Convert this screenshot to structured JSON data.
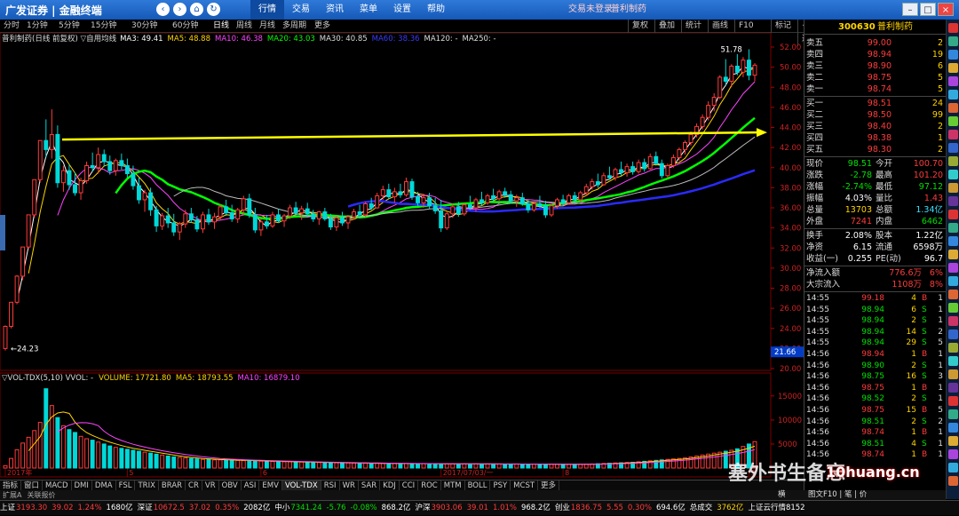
{
  "app": {
    "logo": "广发证券 | 金融终端",
    "menu": [
      "行情",
      "交易",
      "资讯",
      "菜单",
      "设置",
      "帮助"
    ],
    "active_menu": "行情",
    "trade_notice": "交易未登录",
    "title_stock": "普利制药"
  },
  "periods": [
    "分时",
    "1分钟",
    "5分钟",
    "15分钟",
    "30分钟",
    "60分钟",
    "日线",
    "周线",
    "月线",
    "多周期",
    "更多"
  ],
  "selected_period": "日线",
  "tools": [
    "复权",
    "叠加",
    "统计",
    "画线",
    "F10",
    "标记",
    "+自选",
    "返回"
  ],
  "main_legend": {
    "name": "普利制药(日线 前复权) ▽自用均线",
    "ma": [
      {
        "label": "MA3: 49.41",
        "color": "#ffffff"
      },
      {
        "label": "MA5: 48.88",
        "color": "#ffd400"
      },
      {
        "label": "MA10: 46.38",
        "color": "#ff44ff"
      },
      {
        "label": "MA20: 43.03",
        "color": "#00ff00"
      },
      {
        "label": "MA30: 40.85",
        "color": "#dddddd"
      },
      {
        "label": "MA60: 38.36",
        "color": "#3a3aff"
      },
      {
        "label": "MA120: -",
        "color": "#dddddd"
      },
      {
        "label": "MA250: -",
        "color": "#dddddd"
      }
    ]
  },
  "vol_legend": {
    "name": "▽VOL-TDX(5,10) VVOL: -",
    "items": [
      {
        "label": "VOLUME: 17721.80",
        "color": "#ffd400"
      },
      {
        "label": "MA5: 18793.55",
        "color": "#ffd400"
      },
      {
        "label": "MA10: 16879.10",
        "color": "#ff44ff"
      }
    ]
  },
  "chart_data": {
    "type": "candlestick",
    "price_axis": {
      "ylim": [
        20,
        52
      ],
      "ticks": [
        20,
        22,
        24,
        26,
        28,
        30,
        32,
        34,
        36,
        38,
        40,
        42,
        44,
        46,
        48,
        50,
        52
      ],
      "labels": [
        "20.00",
        "22.00",
        "24.00",
        "26.00",
        "28.00",
        "30.00",
        "32.00",
        "34.00",
        "36.00",
        "38.00",
        "40.00",
        "42.00",
        "44.00",
        "46.00",
        "48.00",
        "50.00",
        "52.00"
      ]
    },
    "volume_axis": {
      "ylim": [
        0,
        17000
      ],
      "ticks": [
        5000,
        10000,
        15000
      ]
    },
    "x_labels": [
      {
        "label": "2017年",
        "i": 0
      },
      {
        "label": "5",
        "i": 21
      },
      {
        "label": "6",
        "i": 44
      },
      {
        "label": "2017/07/03/一",
        "i": 75
      },
      {
        "label": "8",
        "i": 96
      },
      {
        "label": "9",
        "i": 128
      }
    ],
    "annotations": {
      "high_label": "51.78",
      "low_label": "24.23",
      "price_tag": "21.66"
    },
    "ohlc": [
      [
        22.0,
        24.3,
        21.8,
        24.2
      ],
      [
        24.2,
        26.6,
        24.0,
        26.6
      ],
      [
        26.6,
        29.3,
        26.4,
        29.2
      ],
      [
        29.2,
        32.1,
        28.8,
        32.1
      ],
      [
        32.1,
        35.3,
        31.9,
        35.3
      ],
      [
        35.3,
        38.8,
        35.0,
        38.8
      ],
      [
        38.8,
        42.7,
        38.5,
        42.7
      ],
      [
        42.7,
        44.8,
        41.0,
        41.8
      ],
      [
        41.8,
        45.8,
        40.9,
        43.3
      ],
      [
        43.3,
        44.2,
        38.0,
        38.5
      ],
      [
        38.5,
        40.2,
        37.6,
        39.7
      ],
      [
        39.7,
        40.3,
        37.8,
        38.3
      ],
      [
        38.3,
        39.5,
        37.2,
        37.5
      ],
      [
        37.5,
        39.0,
        36.8,
        38.7
      ],
      [
        38.7,
        40.6,
        38.4,
        40.2
      ],
      [
        40.2,
        41.5,
        39.6,
        40.0
      ],
      [
        40.0,
        42.0,
        39.4,
        41.3
      ],
      [
        41.3,
        41.8,
        40.1,
        40.6
      ],
      [
        40.6,
        41.2,
        39.3,
        39.7
      ],
      [
        39.7,
        40.9,
        39.2,
        40.7
      ],
      [
        40.7,
        41.4,
        39.8,
        40.2
      ],
      [
        40.2,
        40.9,
        39.0,
        39.4
      ],
      [
        39.4,
        40.2,
        37.8,
        38.2
      ],
      [
        38.2,
        39.0,
        36.4,
        36.8
      ],
      [
        36.8,
        37.8,
        35.6,
        37.5
      ],
      [
        37.5,
        38.0,
        35.2,
        35.8
      ],
      [
        35.8,
        36.2,
        33.6,
        34.2
      ],
      [
        34.2,
        35.5,
        33.8,
        35.2
      ],
      [
        35.2,
        36.0,
        34.0,
        34.5
      ],
      [
        34.5,
        35.4,
        33.2,
        33.6
      ],
      [
        33.6,
        34.6,
        32.8,
        34.4
      ],
      [
        34.4,
        35.8,
        34.0,
        35.4
      ],
      [
        35.4,
        36.0,
        34.5,
        34.8
      ],
      [
        34.8,
        35.2,
        33.6,
        33.9
      ],
      [
        33.9,
        35.6,
        33.5,
        35.3
      ],
      [
        35.3,
        35.9,
        34.3,
        34.6
      ],
      [
        34.6,
        35.5,
        33.9,
        35.1
      ],
      [
        35.1,
        36.4,
        34.8,
        36.1
      ],
      [
        36.1,
        36.8,
        35.2,
        35.5
      ],
      [
        35.5,
        36.3,
        34.6,
        34.9
      ],
      [
        34.9,
        36.0,
        34.5,
        35.8
      ],
      [
        35.8,
        37.2,
        35.3,
        36.9
      ],
      [
        36.9,
        37.4,
        35.0,
        35.3
      ],
      [
        35.3,
        36.0,
        33.5,
        33.8
      ],
      [
        33.8,
        34.9,
        33.2,
        34.6
      ],
      [
        34.6,
        35.3,
        33.9,
        34.2
      ],
      [
        34.2,
        35.6,
        34.0,
        35.3
      ],
      [
        35.3,
        35.9,
        34.5,
        34.7
      ],
      [
        34.7,
        35.4,
        34.1,
        35.2
      ],
      [
        35.2,
        36.3,
        34.9,
        36.0
      ],
      [
        36.0,
        36.6,
        35.2,
        35.5
      ],
      [
        35.5,
        36.2,
        34.8,
        35.9
      ],
      [
        35.9,
        36.5,
        35.1,
        35.4
      ],
      [
        35.4,
        35.8,
        34.6,
        34.9
      ],
      [
        34.9,
        35.7,
        34.3,
        35.6
      ],
      [
        35.6,
        36.0,
        34.7,
        34.9
      ],
      [
        34.9,
        35.4,
        33.8,
        34.1
      ],
      [
        34.1,
        35.2,
        33.7,
        35.0
      ],
      [
        35.0,
        35.6,
        34.2,
        34.5
      ],
      [
        34.5,
        35.3,
        33.9,
        35.1
      ],
      [
        35.1,
        35.9,
        34.8,
        35.6
      ],
      [
        35.6,
        36.3,
        35.0,
        35.3
      ],
      [
        35.3,
        36.6,
        35.1,
        36.4
      ],
      [
        36.4,
        37.0,
        35.8,
        36.0
      ],
      [
        36.0,
        37.5,
        35.9,
        37.2
      ],
      [
        37.2,
        38.2,
        36.8,
        37.8
      ],
      [
        37.8,
        38.4,
        36.9,
        37.1
      ],
      [
        37.1,
        38.0,
        36.5,
        37.6
      ],
      [
        37.6,
        38.4,
        37.0,
        37.3
      ],
      [
        37.3,
        39.0,
        37.1,
        38.6
      ],
      [
        38.6,
        38.9,
        36.8,
        37.1
      ],
      [
        37.1,
        37.6,
        36.2,
        36.5
      ],
      [
        36.5,
        37.4,
        36.0,
        37.0
      ],
      [
        37.0,
        37.5,
        35.9,
        36.2
      ],
      [
        36.2,
        37.0,
        35.4,
        35.7
      ],
      [
        35.7,
        36.8,
        33.6,
        34.0
      ],
      [
        34.0,
        35.6,
        33.8,
        35.4
      ],
      [
        35.4,
        36.4,
        35.0,
        36.1
      ],
      [
        36.1,
        36.6,
        35.1,
        35.4
      ],
      [
        35.4,
        36.5,
        35.2,
        36.3
      ],
      [
        36.3,
        37.2,
        35.8,
        36.0
      ],
      [
        36.0,
        37.0,
        35.6,
        36.8
      ],
      [
        36.8,
        37.6,
        36.2,
        36.5
      ],
      [
        36.5,
        37.4,
        36.3,
        37.2
      ],
      [
        37.2,
        37.9,
        36.6,
        36.9
      ],
      [
        36.9,
        37.8,
        36.7,
        37.6
      ],
      [
        37.6,
        38.0,
        37.0,
        37.3
      ],
      [
        37.3,
        37.7,
        36.4,
        36.7
      ],
      [
        36.7,
        37.3,
        36.1,
        37.0
      ],
      [
        37.0,
        37.5,
        36.2,
        36.4
      ],
      [
        36.4,
        36.8,
        35.5,
        35.8
      ],
      [
        35.8,
        36.6,
        35.6,
        36.4
      ],
      [
        36.4,
        37.2,
        36.0,
        36.2
      ],
      [
        36.2,
        36.7,
        35.0,
        35.3
      ],
      [
        35.3,
        36.4,
        35.1,
        36.2
      ],
      [
        36.2,
        37.0,
        35.9,
        36.8
      ],
      [
        36.8,
        37.3,
        36.2,
        36.5
      ],
      [
        36.5,
        37.4,
        36.3,
        37.2
      ],
      [
        37.2,
        37.6,
        36.5,
        36.8
      ],
      [
        36.8,
        37.7,
        36.6,
        37.5
      ],
      [
        37.5,
        38.4,
        37.2,
        38.1
      ],
      [
        38.1,
        38.9,
        37.8,
        38.6
      ],
      [
        38.6,
        39.4,
        38.0,
        38.3
      ],
      [
        38.3,
        39.5,
        38.2,
        39.2
      ],
      [
        39.2,
        40.1,
        38.8,
        39.0
      ],
      [
        39.0,
        40.0,
        38.7,
        39.8
      ],
      [
        39.8,
        40.6,
        39.2,
        39.5
      ],
      [
        39.5,
        40.4,
        39.1,
        40.1
      ],
      [
        40.1,
        40.6,
        39.3,
        39.6
      ],
      [
        39.6,
        40.8,
        39.4,
        40.5
      ],
      [
        40.5,
        40.9,
        39.6,
        39.9
      ],
      [
        39.9,
        41.4,
        39.8,
        41.1
      ],
      [
        41.1,
        41.6,
        40.2,
        40.4
      ],
      [
        40.4,
        40.8,
        38.9,
        39.2
      ],
      [
        39.2,
        40.4,
        39.0,
        40.2
      ],
      [
        40.2,
        41.3,
        40.0,
        41.0
      ],
      [
        41.0,
        42.0,
        40.7,
        41.8
      ],
      [
        41.8,
        42.7,
        41.3,
        42.5
      ],
      [
        42.5,
        43.6,
        42.2,
        43.3
      ],
      [
        43.3,
        44.4,
        43.0,
        44.1
      ],
      [
        44.1,
        45.3,
        43.8,
        45.0
      ],
      [
        45.0,
        46.6,
        44.7,
        46.2
      ],
      [
        46.2,
        47.4,
        45.6,
        47.0
      ],
      [
        47.0,
        49.2,
        46.8,
        49.0
      ],
      [
        49.0,
        50.8,
        48.2,
        48.6
      ],
      [
        48.6,
        50.3,
        48.0,
        50.1
      ],
      [
        50.1,
        51.3,
        49.2,
        49.5
      ],
      [
        49.5,
        51.0,
        49.0,
        50.7
      ],
      [
        50.7,
        51.78,
        48.7,
        49.2
      ],
      [
        49.2,
        50.4,
        48.6,
        50.2
      ]
    ],
    "volume": [
      500,
      2000,
      3800,
      5200,
      6400,
      7800,
      9500,
      16500,
      13000,
      10500,
      8800,
      8000,
      7400,
      6600,
      6100,
      5800,
      5400,
      5000,
      4600,
      4300,
      4100,
      3900,
      3700,
      3500,
      3300,
      3100,
      2900,
      2700,
      2500,
      2300,
      2200,
      2100,
      2000,
      1900,
      1800,
      1800,
      1700,
      1700,
      1650,
      1600,
      1600,
      1550,
      1500,
      1500,
      1450,
      1400,
      1400,
      1350,
      1300,
      1300,
      1250,
      1250,
      1200,
      1200,
      1150,
      1150,
      1100,
      1100,
      1100,
      1050,
      1050,
      1000,
      1000,
      1000,
      980,
      960,
      950,
      940,
      930,
      920,
      920,
      910,
      900,
      900,
      890,
      880,
      880,
      870,
      870,
      860,
      860,
      850,
      850,
      840,
      840,
      830,
      830,
      830,
      820,
      820,
      810,
      810,
      800,
      800,
      800,
      790,
      790,
      780,
      780,
      780,
      800,
      850,
      900,
      950,
      1000,
      1050,
      1100,
      1150,
      1200,
      1300,
      1400,
      1500,
      1600,
      1700,
      1800,
      1900,
      2000,
      2100,
      2300,
      2500,
      2700,
      2900,
      3100,
      3300,
      3500,
      3700,
      4000,
      4500,
      5000,
      5500
    ]
  },
  "right_panel": {
    "code": "300630",
    "name": "普利制药",
    "asks": [
      {
        "label": "卖五",
        "price": "99.00",
        "vol": "2"
      },
      {
        "label": "卖四",
        "price": "98.94",
        "vol": "19"
      },
      {
        "label": "卖三",
        "price": "98.90",
        "vol": "6"
      },
      {
        "label": "卖二",
        "price": "98.75",
        "vol": "5"
      },
      {
        "label": "卖一",
        "price": "98.74",
        "vol": "5"
      }
    ],
    "bids": [
      {
        "label": "买一",
        "price": "98.51",
        "vol": "24"
      },
      {
        "label": "买二",
        "price": "98.50",
        "vol": "99"
      },
      {
        "label": "买三",
        "price": "98.40",
        "vol": "2"
      },
      {
        "label": "买四",
        "price": "98.38",
        "vol": "1"
      },
      {
        "label": "买五",
        "price": "98.30",
        "vol": "2"
      }
    ],
    "stats": [
      {
        "l1": "现价",
        "v1": "98.51",
        "c1": "#00e000",
        "l2": "今开",
        "v2": "100.70",
        "c2": "#ff3b3b"
      },
      {
        "l1": "涨跌",
        "v1": "-2.78",
        "c1": "#00e000",
        "l2": "最高",
        "v2": "101.20",
        "c2": "#ff3b3b"
      },
      {
        "l1": "涨幅",
        "v1": "-2.74%",
        "c1": "#00e000",
        "l2": "最低",
        "v2": "97.12",
        "c2": "#00e000"
      },
      {
        "l1": "振幅",
        "v1": "4.03%",
        "c1": "#ffffff",
        "l2": "量比",
        "v2": "1.43",
        "c2": "#ff3b3b"
      },
      {
        "l1": "总量",
        "v1": "13703",
        "c1": "#ffd400",
        "l2": "总额",
        "v2": "1.34亿",
        "c2": "#39e0ff"
      },
      {
        "l1": "外盘",
        "v1": "7241",
        "c1": "#ff3b3b",
        "l2": "内盘",
        "v2": "6462",
        "c2": "#00e000"
      }
    ],
    "stats2": [
      {
        "l1": "换手",
        "v1": "2.08%",
        "l2": "股本",
        "v2": "1.22亿"
      },
      {
        "l1": "净资",
        "v1": "6.15",
        "l2": "流通",
        "v2": "6598万"
      },
      {
        "l1": "收益(一)",
        "v1": "0.255",
        "l2": "PE(动)",
        "v2": "96.7"
      }
    ],
    "flows": [
      {
        "label": "净流入额",
        "value": "776.6万",
        "pct": "6%"
      },
      {
        "label": "大宗流入",
        "value": "1108万",
        "pct": "8%"
      }
    ],
    "ticks": [
      {
        "t": "14:55",
        "p": "99.18",
        "q": "4",
        "s": "B",
        "c": "1"
      },
      {
        "t": "14:55",
        "p": "98.94",
        "q": "6",
        "s": "S",
        "c": "1"
      },
      {
        "t": "14:55",
        "p": "98.94",
        "q": "2",
        "s": "S",
        "c": "1"
      },
      {
        "t": "14:55",
        "p": "98.94",
        "q": "14",
        "s": "S",
        "c": "2"
      },
      {
        "t": "14:55",
        "p": "98.94",
        "q": "29",
        "s": "S",
        "c": "5"
      },
      {
        "t": "14:56",
        "p": "98.94",
        "q": "1",
        "s": "B",
        "c": "1"
      },
      {
        "t": "14:56",
        "p": "98.90",
        "q": "2",
        "s": "S",
        "c": "1"
      },
      {
        "t": "14:56",
        "p": "98.75",
        "q": "16",
        "s": "S",
        "c": "3"
      },
      {
        "t": "14:56",
        "p": "98.75",
        "q": "1",
        "s": "B",
        "c": "1"
      },
      {
        "t": "14:56",
        "p": "98.52",
        "q": "2",
        "s": "S",
        "c": "1"
      },
      {
        "t": "14:56",
        "p": "98.75",
        "q": "15",
        "s": "B",
        "c": "5"
      },
      {
        "t": "14:56",
        "p": "98.51",
        "q": "2",
        "s": "S",
        "c": "2"
      },
      {
        "t": "14:56",
        "p": "98.74",
        "q": "1",
        "s": "B",
        "c": "1"
      },
      {
        "t": "14:56",
        "p": "98.51",
        "q": "4",
        "s": "S",
        "c": "1"
      },
      {
        "t": "14:56",
        "p": "98.74",
        "q": "1",
        "s": "B",
        "c": "1"
      }
    ],
    "bottom_label": "图文F10 | 笔 | 价"
  },
  "indicator_tabs": [
    "指标",
    "窗口",
    "MACD",
    "DMI",
    "DMA",
    "FSL",
    "TRIX",
    "BRAR",
    "CR",
    "VR",
    "OBV",
    "ASI",
    "EMV",
    "VOL-TDX",
    "RSI",
    "WR",
    "SAR",
    "KDJ",
    "CCI",
    "ROC",
    "MTM",
    "BOLL",
    "PSY",
    "MCST",
    "更多"
  ],
  "selected_tab": "VOL-TDX",
  "sub_tabs": [
    "扩展A",
    "关联报价"
  ],
  "sub_right": "横",
  "status": [
    {
      "label": "上证",
      "val": "3193.30",
      "chg": "39.02",
      "pct": "1.24%",
      "amt": "1680亿"
    },
    {
      "label": "深证",
      "val": "10672.5",
      "chg": "37.02",
      "pct": "0.35%",
      "amt": "2082亿"
    },
    {
      "label": "中小",
      "val": "7341.24",
      "chg": "-5.76",
      "pct": "-0.08%",
      "amt": "868.2亿"
    },
    {
      "label": "沪深",
      "val": "3903.06",
      "chg": "39.01",
      "pct": "1.01%",
      "amt": "968.2亿"
    },
    {
      "label": "创业",
      "val": "1836.75",
      "chg": "5.55",
      "pct": "0.30%",
      "amt": "694.6亿"
    }
  ],
  "status_tail": [
    "总成交",
    "3762亿",
    "上证云行情8152"
  ],
  "watermark": "塞外书生备忘",
  "watermark2": "10huang.cn"
}
